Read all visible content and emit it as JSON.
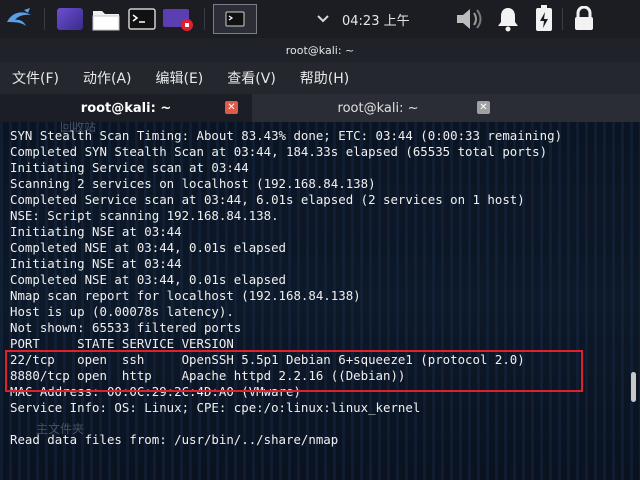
{
  "panel": {
    "clock": "04:23 上午",
    "icons": [
      "kali-menu-icon",
      "workspace-icon",
      "file-manager-icon",
      "terminal-app-icon",
      "screen-recorder-icon",
      "terminal-task-icon",
      "chevron-down-icon",
      "volume-icon",
      "notification-bell-icon",
      "power-charge-icon",
      "lock-icon"
    ]
  },
  "window": {
    "title": "root@kali: ~"
  },
  "menubar": {
    "items": [
      "文件(F)",
      "动作(A)",
      "编辑(E)",
      "查看(V)",
      "帮助(H)"
    ]
  },
  "tabs": [
    {
      "label": "root@kali: ~",
      "active": true
    },
    {
      "label": "root@kali: ~",
      "active": false
    }
  ],
  "terminal": {
    "lines": [
      "SYN Stealth Scan Timing: About 83.43% done; ETC: 03:44 (0:00:33 remaining)",
      "Completed SYN Stealth Scan at 03:44, 184.33s elapsed (65535 total ports)",
      "Initiating Service scan at 03:44",
      "Scanning 2 services on localhost (192.168.84.138)",
      "Completed Service scan at 03:44, 6.01s elapsed (2 services on 1 host)",
      "NSE: Script scanning 192.168.84.138.",
      "Initiating NSE at 03:44",
      "Completed NSE at 03:44, 0.01s elapsed",
      "Initiating NSE at 03:44",
      "Completed NSE at 03:44, 0.01s elapsed",
      "Nmap scan report for localhost (192.168.84.138)",
      "Host is up (0.00078s latency).",
      "Not shown: 65533 filtered ports",
      "PORT     STATE SERVICE VERSION",
      "22/tcp   open  ssh     OpenSSH 5.5p1 Debian 6+squeeze1 (protocol 2.0)",
      "8880/tcp open  http    Apache httpd 2.2.16 ((Debian))",
      "MAC Address: 00:0C:29:2C:4D:A0 (VMware)",
      "Service Info: OS: Linux; CPE: cpe:/o:linux:linux_kernel",
      "",
      "Read data files from: /usr/bin/../share/nmap"
    ],
    "ghost_labels": [
      "回收站",
      "主文件夹"
    ]
  },
  "colors": {
    "highlight_border": "#e0202a",
    "close_active": "#e05a4a"
  }
}
